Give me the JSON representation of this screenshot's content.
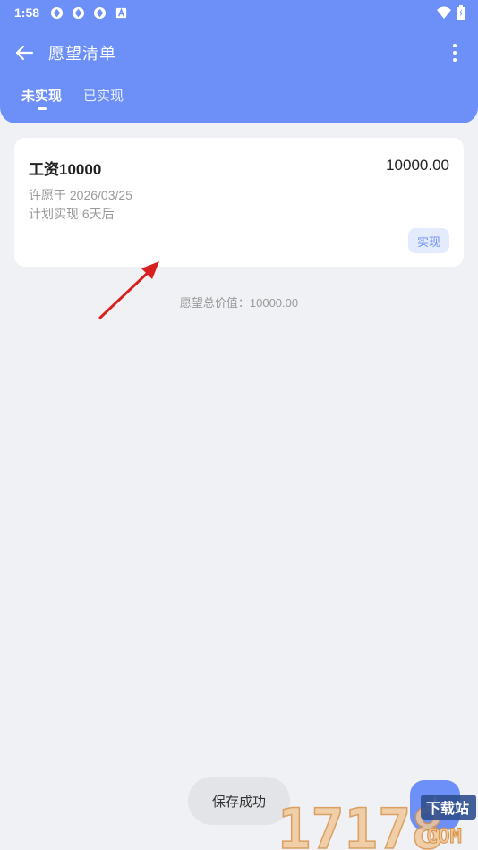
{
  "status_bar": {
    "time": "1:58"
  },
  "app_bar": {
    "title": "愿望清单"
  },
  "tabs": [
    {
      "label": "未实现",
      "active": true
    },
    {
      "label": "已实现",
      "active": false
    }
  ],
  "wish_card": {
    "name": "工资10000",
    "amount": "10000.00",
    "wished_on": "许愿于 2026/03/25",
    "planned": "计划实现 6天后",
    "realize_label": "实现"
  },
  "summary": {
    "total_text": "愿望总价值：10000.00"
  },
  "toast": {
    "message": "保存成功"
  },
  "watermark": {
    "digits": "17178",
    "text": "下载站",
    "com": "COM"
  },
  "colors": {
    "accent": "#6d8ff8",
    "background": "#f0f1f5",
    "annotation_arrow": "#d9201f"
  }
}
